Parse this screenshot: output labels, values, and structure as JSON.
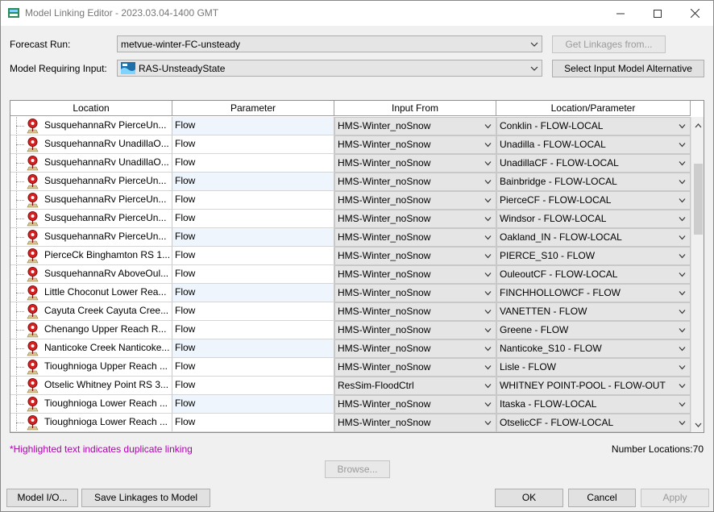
{
  "window": {
    "title": "Model Linking Editor - 2023.03.04-1400 GMT"
  },
  "form": {
    "forecast_run_label": "Forecast Run:",
    "forecast_run_value": "metvue-winter-FC-unsteady",
    "model_input_label": "Model Requiring Input:",
    "model_input_value": "RAS-UnsteadyState",
    "get_linkages_label": "Get Linkages from...",
    "select_alt_label": "Select Input Model Alternative"
  },
  "table": {
    "columns": [
      "Location",
      "Parameter",
      "Input From",
      "Location/Parameter"
    ],
    "rows": [
      {
        "location": "SusquehannaRv PierceUn...",
        "parameter": "Flow",
        "input_from": "HMS-Winter_noSnow",
        "loc_param": "Conklin - FLOW-LOCAL"
      },
      {
        "location": "SusquehannaRv UnadillaO...",
        "parameter": "Flow",
        "input_from": "HMS-Winter_noSnow",
        "loc_param": "Unadilla - FLOW-LOCAL"
      },
      {
        "location": "SusquehannaRv UnadillaO...",
        "parameter": "Flow",
        "input_from": "HMS-Winter_noSnow",
        "loc_param": "UnadillaCF - FLOW-LOCAL"
      },
      {
        "location": "SusquehannaRv PierceUn...",
        "parameter": "Flow",
        "input_from": "HMS-Winter_noSnow",
        "loc_param": "Bainbridge - FLOW-LOCAL"
      },
      {
        "location": "SusquehannaRv PierceUn...",
        "parameter": "Flow",
        "input_from": "HMS-Winter_noSnow",
        "loc_param": "PierceCF - FLOW-LOCAL"
      },
      {
        "location": "SusquehannaRv PierceUn...",
        "parameter": "Flow",
        "input_from": "HMS-Winter_noSnow",
        "loc_param": "Windsor - FLOW-LOCAL"
      },
      {
        "location": "SusquehannaRv PierceUn...",
        "parameter": "Flow",
        "input_from": "HMS-Winter_noSnow",
        "loc_param": "Oakland_IN - FLOW-LOCAL"
      },
      {
        "location": "PierceCk Binghamton RS 1...",
        "parameter": "Flow",
        "input_from": "HMS-Winter_noSnow",
        "loc_param": "PIERCE_S10 - FLOW"
      },
      {
        "location": "SusquehannaRv AboveOul...",
        "parameter": "Flow",
        "input_from": "HMS-Winter_noSnow",
        "loc_param": "OuleoutCF - FLOW-LOCAL"
      },
      {
        "location": "Little Choconut Lower Rea...",
        "parameter": "Flow",
        "input_from": "HMS-Winter_noSnow",
        "loc_param": "FINCHHOLLOWCF - FLOW"
      },
      {
        "location": "Cayuta Creek Cayuta Cree...",
        "parameter": "Flow",
        "input_from": "HMS-Winter_noSnow",
        "loc_param": "VANETTEN - FLOW"
      },
      {
        "location": "Chenango Upper Reach R...",
        "parameter": "Flow",
        "input_from": "HMS-Winter_noSnow",
        "loc_param": "Greene - FLOW"
      },
      {
        "location": "Nanticoke Creek Nanticoke...",
        "parameter": "Flow",
        "input_from": "HMS-Winter_noSnow",
        "loc_param": "Nanticoke_S10 - FLOW"
      },
      {
        "location": "Tioughnioga Upper Reach ...",
        "parameter": "Flow",
        "input_from": "HMS-Winter_noSnow",
        "loc_param": "Lisle - FLOW"
      },
      {
        "location": "Otselic Whitney Point RS 3...",
        "parameter": "Flow",
        "input_from": "ResSim-FloodCtrl",
        "loc_param": "WHITNEY POINT-POOL - FLOW-OUT"
      },
      {
        "location": "Tioughnioga Lower Reach ...",
        "parameter": "Flow",
        "input_from": "HMS-Winter_noSnow",
        "loc_param": "Itaska - FLOW-LOCAL"
      },
      {
        "location": "Tioughnioga Lower Reach ...",
        "parameter": "Flow",
        "input_from": "HMS-Winter_noSnow",
        "loc_param": "OtselicCF - FLOW-LOCAL"
      }
    ]
  },
  "footer": {
    "note": "*Highlighted text indicates duplicate linking",
    "count": "Number Locations:70",
    "browse_label": "Browse...",
    "model_io_label": "Model I/O...",
    "save_linkages_label": "Save Linkages to Model",
    "ok_label": "OK",
    "cancel_label": "Cancel",
    "apply_label": "Apply"
  },
  "colors": {
    "note": "#b000b0",
    "pin": "#d42020",
    "row_alt": "#eef5fd"
  }
}
